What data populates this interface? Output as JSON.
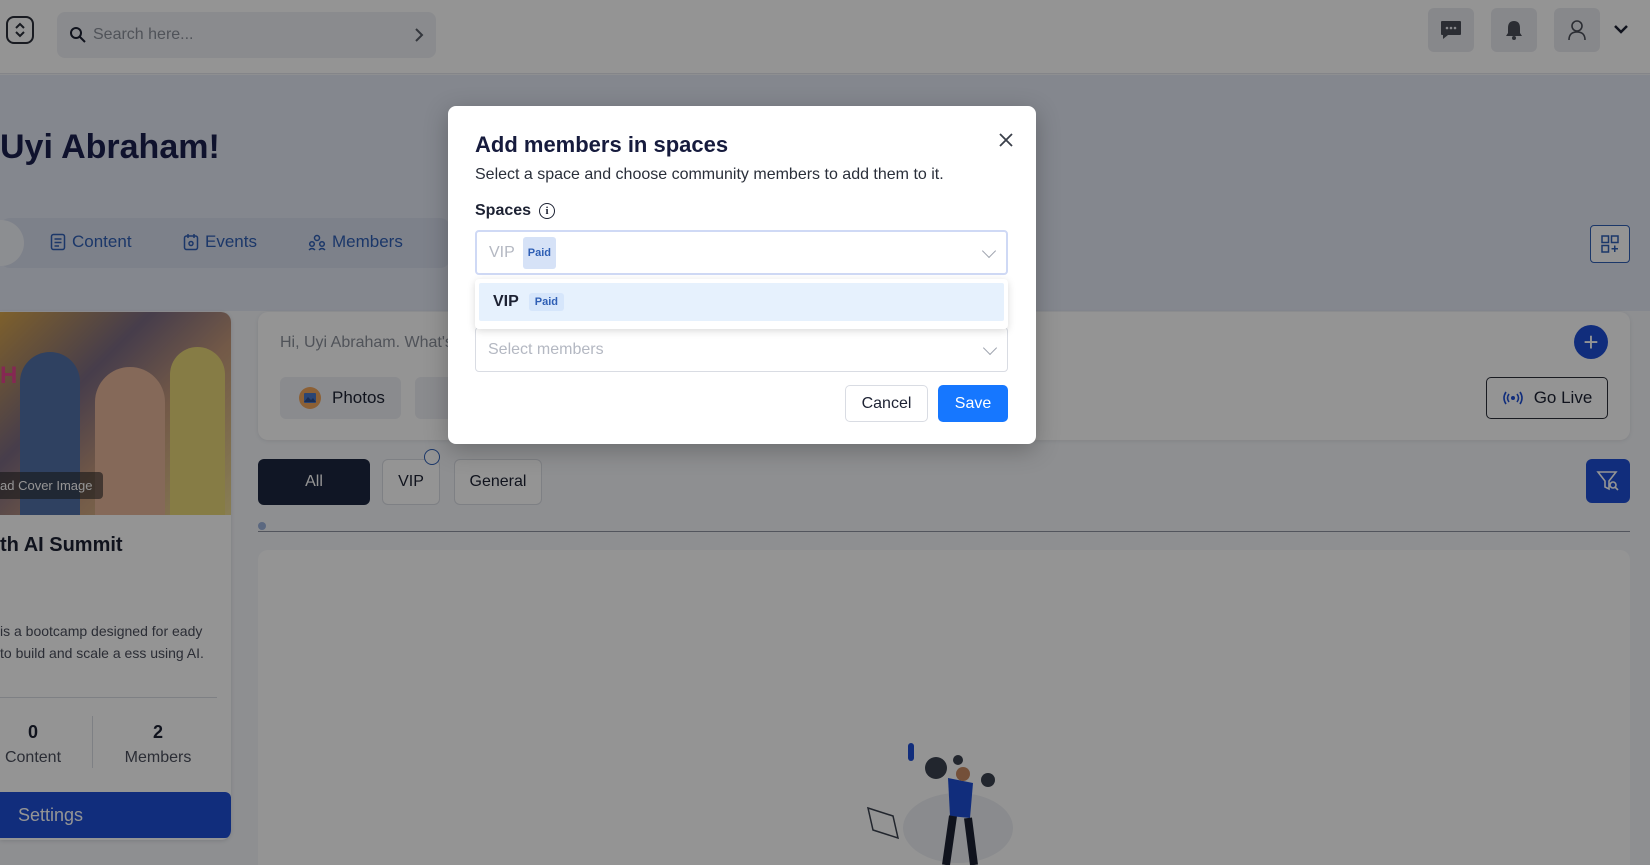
{
  "topbar": {
    "search_placeholder": "Search here..."
  },
  "hero": {
    "greeting": "Uyi Abraham!",
    "tabs": [
      "Content",
      "Events",
      "Members"
    ]
  },
  "card": {
    "cover_letter": "H",
    "upload_label": "ad Cover Image",
    "title": "th AI Summit",
    "description": "is a bootcamp designed for eady to build and scale a ess using AI.",
    "stats": [
      {
        "value": "0",
        "label": "Content"
      },
      {
        "value": "2",
        "label": "Members"
      }
    ],
    "settings_label": "Settings"
  },
  "composer": {
    "hint": "Hi, Uyi Abraham. What's",
    "photos_label": "Photos",
    "golive_label": "Go Live"
  },
  "filters": [
    "All",
    "VIP",
    "General"
  ],
  "modal": {
    "title": "Add members in spaces",
    "subtitle": "Select a space and choose community members to add them to it.",
    "spaces_label": "Spaces",
    "spaces_info_glyph": "i",
    "spaces_value": "VIP",
    "spaces_badge": "Paid",
    "dropdown_option": {
      "label": "VIP",
      "badge": "Paid"
    },
    "members_placeholder": "Select members",
    "cancel_label": "Cancel",
    "save_label": "Save"
  },
  "colors": {
    "primary": "#1e4fd6",
    "save_button": "#1677ff",
    "dark_pill": "#1d2740",
    "badge_text": "#2f5fb5"
  },
  "icons": [
    "app-logo-icon",
    "search-icon",
    "chevron-right-icon",
    "chat-icon",
    "bell-icon",
    "user-icon",
    "chevron-down-icon",
    "content-icon",
    "events-icon",
    "members-icon",
    "grid-add-icon",
    "plus-icon",
    "photo-icon",
    "broadcast-icon",
    "lock-icon",
    "filter-icon",
    "close-icon",
    "info-icon"
  ]
}
